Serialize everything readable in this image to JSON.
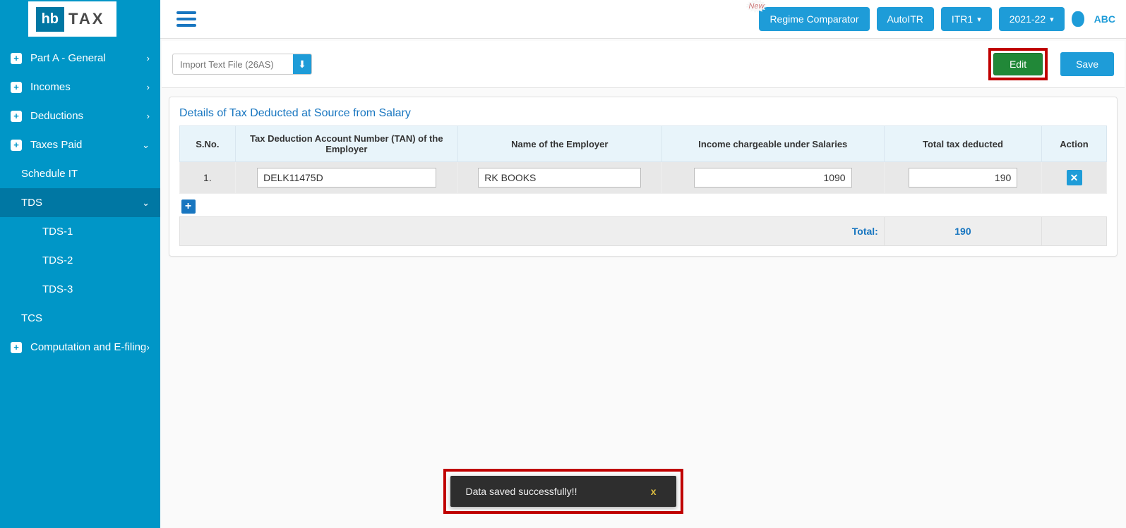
{
  "logo": {
    "hb": "hb",
    "tax": "TAX"
  },
  "sidebar": {
    "items": [
      {
        "label": "Part A - General",
        "icon": true,
        "chev": "›"
      },
      {
        "label": "Incomes",
        "icon": true,
        "chev": "›"
      },
      {
        "label": "Deductions",
        "icon": true,
        "chev": "›"
      },
      {
        "label": "Taxes Paid",
        "icon": true,
        "chev": "⌄"
      },
      {
        "label": "Schedule IT",
        "sub": true
      },
      {
        "label": "TDS",
        "sub": true,
        "chev": "⌄",
        "active": true
      },
      {
        "label": "TDS-1",
        "sub2": true
      },
      {
        "label": "TDS-2",
        "sub2": true
      },
      {
        "label": "TDS-3",
        "sub2": true
      },
      {
        "label": "TCS",
        "sub": true
      },
      {
        "label": "Computation and E-filing",
        "icon": true,
        "chev": "›"
      }
    ]
  },
  "topbar": {
    "new_tag": "New",
    "regime": "Regime Comparator",
    "autoitr": "AutoITR",
    "itr": "ITR1",
    "year": "2021-22",
    "user": "ABC"
  },
  "actionbar": {
    "import_placeholder": "Import Text File (26AS)",
    "edit": "Edit",
    "save": "Save"
  },
  "panel": {
    "title": "Details of Tax Deducted at Source from Salary",
    "headers": {
      "sno": "S.No.",
      "tan": "Tax Deduction Account Number (TAN) of the Employer",
      "employer": "Name of the Employer",
      "income": "Income chargeable under Salaries",
      "deducted": "Total tax deducted",
      "action": "Action"
    },
    "rows": [
      {
        "sno": "1.",
        "tan": "DELK11475D",
        "employer": "RK BOOKS",
        "income": "1090",
        "deducted": "190"
      }
    ],
    "add": "+",
    "total_label": "Total:",
    "total_value": "190"
  },
  "toast": {
    "msg": "Data saved successfully!!",
    "close": "x"
  }
}
